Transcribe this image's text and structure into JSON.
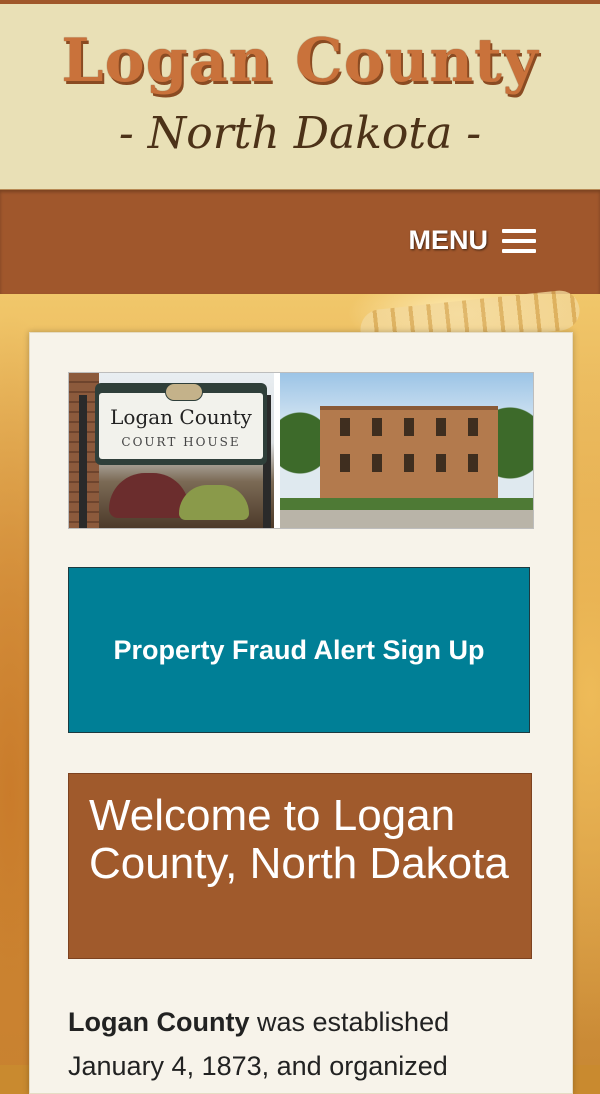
{
  "header": {
    "title": "Logan County",
    "subtitle": "- North Dakota -"
  },
  "nav": {
    "menu_label": "MENU"
  },
  "photos": {
    "sign_name": "Logan County",
    "sign_sub": "COURT HOUSE"
  },
  "alert": {
    "label": "Property Fraud Alert Sign Up"
  },
  "welcome": {
    "heading": "Welcome to Logan County, North Dakota"
  },
  "intro": {
    "bold": "Logan County",
    "rest": " was established January 4, 1873, and organized"
  },
  "colors": {
    "header_bg": "#e9e0b6",
    "nav_bg": "#a0572c",
    "alert_bg": "#007f96",
    "welcome_bg": "#a05a2c"
  }
}
